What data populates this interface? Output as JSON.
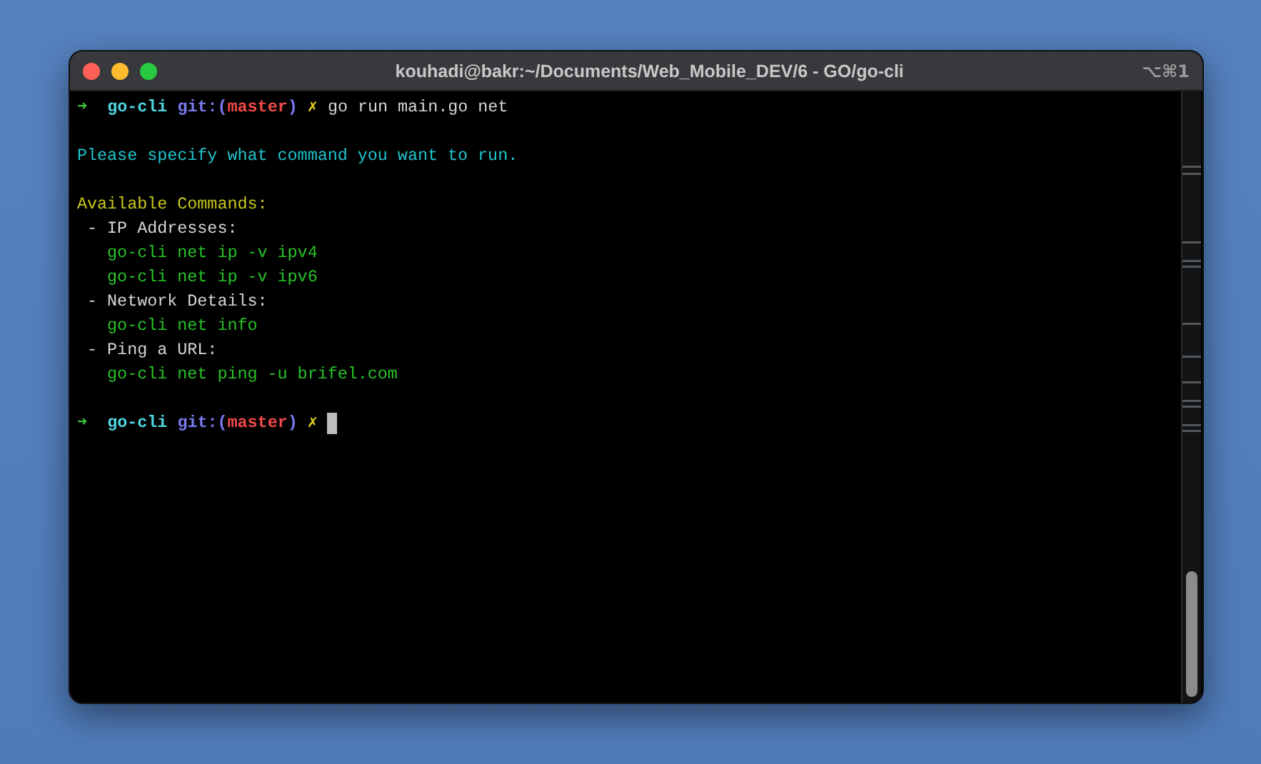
{
  "window": {
    "title": "kouhadi@bakr:~/Documents/Web_Mobile_DEV/6 - GO/go-cli",
    "shortcut": "⌥⌘1"
  },
  "lines": [
    {
      "kind": "prompt",
      "arrow": "➜",
      "directory": "go-cli",
      "git_open": "git:(",
      "branch": "master",
      "git_close": ")",
      "dirty": "✗",
      "command": "go run main.go net",
      "cursor": false
    },
    {
      "kind": "blank"
    },
    {
      "kind": "info",
      "text": "Please specify what command you want to run."
    },
    {
      "kind": "blank"
    },
    {
      "kind": "heading",
      "text": "Available Commands:"
    },
    {
      "kind": "plain",
      "text": " - IP Addresses:"
    },
    {
      "kind": "command",
      "text": "   go-cli net ip -v ipv4"
    },
    {
      "kind": "command",
      "text": "   go-cli net ip -v ipv6"
    },
    {
      "kind": "plain",
      "text": " - Network Details:"
    },
    {
      "kind": "command",
      "text": "   go-cli net info"
    },
    {
      "kind": "plain",
      "text": " - Ping a URL:"
    },
    {
      "kind": "command",
      "text": "   go-cli net ping -u brifel.com"
    },
    {
      "kind": "blank"
    },
    {
      "kind": "prompt",
      "arrow": "➜",
      "directory": "go-cli",
      "git_open": "git:(",
      "branch": "master",
      "git_close": ")",
      "dirty": "✗",
      "cursor": true
    }
  ]
}
